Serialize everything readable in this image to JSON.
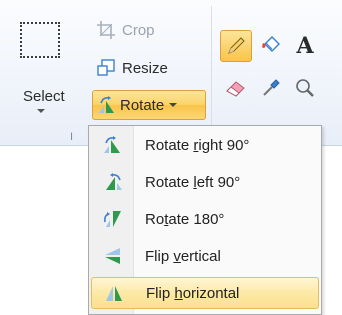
{
  "ribbon": {
    "group_label": "I",
    "select": {
      "label": "Select"
    },
    "crop": {
      "label": "Crop"
    },
    "resize": {
      "label": "Resize"
    },
    "rotate": {
      "label": "Rotate"
    },
    "tools": [
      {
        "name": "pencil",
        "active": true
      },
      {
        "name": "fill"
      },
      {
        "name": "text",
        "glyph": "A"
      },
      {
        "name": "eraser"
      },
      {
        "name": "color-picker"
      },
      {
        "name": "magnifier"
      }
    ]
  },
  "rotate_menu": {
    "items": [
      {
        "pre": "Rotate ",
        "key": "r",
        "post": "ight 90°"
      },
      {
        "pre": "Rotate ",
        "key": "l",
        "post": "eft 90°"
      },
      {
        "pre": "Ro",
        "key": "t",
        "post": "ate 180°"
      },
      {
        "pre": "Flip ",
        "key": "v",
        "post": "ertical"
      },
      {
        "pre": "Flip ",
        "key": "h",
        "post": "orizontal"
      }
    ],
    "highlighted_index": 4
  },
  "colors": {
    "accent_gold": "#f9c44a",
    "accent_border": "#d9a23e",
    "icon_blue": "#3a7fd0",
    "icon_green": "#2f9a4d"
  }
}
